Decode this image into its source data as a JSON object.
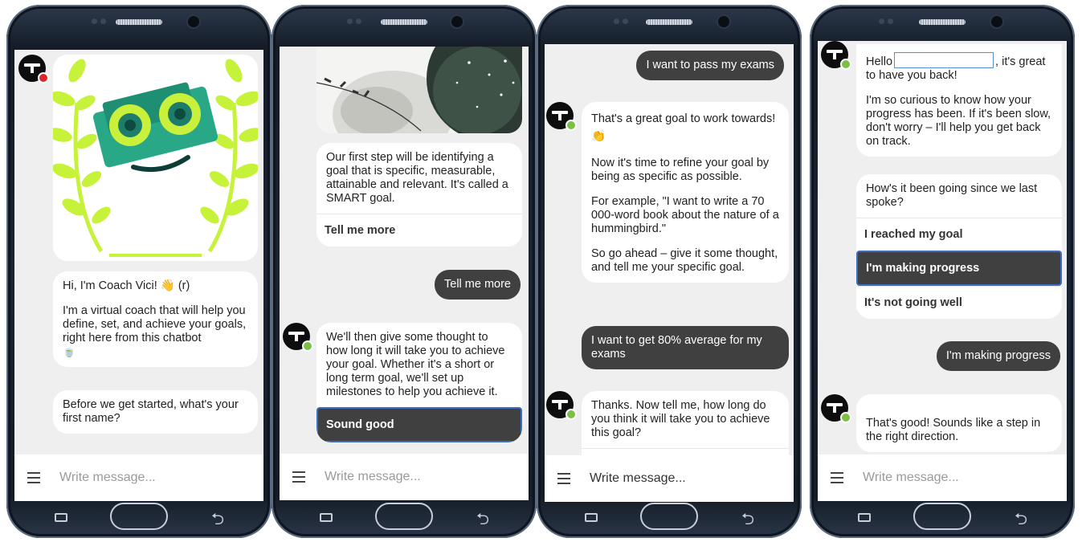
{
  "colors": {
    "online": "#7bc043",
    "offline": "#d8262c",
    "user_bubble": "#404040",
    "chat_bg": "#efefef",
    "selected_outline": "#3c6fc2",
    "robot_bg": "#29a887",
    "robot_eye": "#c9f03a",
    "laurel": "#c7f23a"
  },
  "icons": {
    "menu": "hamburger-menu-icon",
    "wave": "waving-hand-emoji",
    "clap": "clapping-hands-emoji",
    "teacup": "teacup-emoji",
    "recent": "recent-apps-icon",
    "back": "back-arrow-icon"
  },
  "screen1": {
    "greeting_line": "Hi, I'm Coach Vici! 👋 (r)",
    "intro": "I'm a virtual coach that will help you define, set, and achieve your goals, right here from this chatbot",
    "intro_emoji": "🍵",
    "name_question": "Before we get started, what's your first name?",
    "composer_placeholder": "Write message..."
  },
  "screen2": {
    "smart_message": "Our first step will be identifying a goal that is specific, measurable, attainable and relevant. It's called a SMART goal.",
    "option_tell_more": "Tell me more",
    "user_reply": "Tell me more",
    "milestone_message": "We'll then give some thought to how long it will take you to achieve your goal. Whether it's a short or long term goal, we'll set up milestones to help you achieve it.",
    "option_sound_good": "Sound good",
    "composer_placeholder": "Write message..."
  },
  "screen3": {
    "user_goal": "I want to pass my exams",
    "great_goal": "That's a great goal to work towards! 👏",
    "refine": "Now it's time to refine your goal by being as specific as possible.",
    "example": "For example, \"I want to write a 70 000-word book about the nature of a hummingbird.\"",
    "go_ahead": "So go ahead – give it some thought, and tell me your specific goal.",
    "user_specific_goal": "I want to get 80% average for my exams",
    "how_long": "Thanks. Now tell me, how long do you think it will take you to achieve this goal?",
    "composer_value": "Write message..."
  },
  "screen4": {
    "hello_prefix": "Hello",
    "hello_suffix": ", it's great to have you back!",
    "curious": "I'm so curious to know how your progress has been. If it's been slow, don't worry – I'll help you get back on track.",
    "how_going": "How's it been going since we last spoke?",
    "option_reached": "I reached my goal",
    "option_progress": "I'm making progress",
    "option_not_well": "It's not going well",
    "user_reply": "I'm making progress",
    "good_reply": "That's good! Sounds like a step in the right direction.",
    "composer_placeholder": "Write message..."
  }
}
